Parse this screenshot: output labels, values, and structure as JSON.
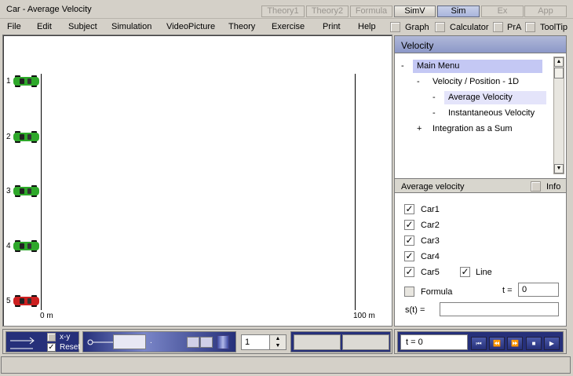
{
  "window": {
    "title": "Car - Average Velocity"
  },
  "mode_tabs": [
    {
      "label": "Theory1",
      "state": "disabled"
    },
    {
      "label": "Theory2",
      "state": "disabled"
    },
    {
      "label": "Formula",
      "state": "disabled"
    },
    {
      "label": "SimV",
      "state": "enabled"
    },
    {
      "label": "Sim",
      "state": "active"
    },
    {
      "label": "Ex",
      "state": "disabled"
    },
    {
      "label": "App",
      "state": "disabled"
    }
  ],
  "menu": {
    "items": [
      "File",
      "Edit",
      "Subject",
      "Simulation",
      "VideoPicture",
      "Theory",
      "Exercise",
      "Print",
      "Help"
    ],
    "toggles": [
      "Graph",
      "Calculator",
      "PrA",
      "ToolTip"
    ]
  },
  "simulation": {
    "start_label": "0 m",
    "end_label": "100 m",
    "cars": [
      {
        "number": "1",
        "color": "#2ea82a",
        "position_m": 0
      },
      {
        "number": "2",
        "color": "#2ea82a",
        "position_m": 0
      },
      {
        "number": "3",
        "color": "#2ea82a",
        "position_m": 0
      },
      {
        "number": "4",
        "color": "#2ea82a",
        "position_m": 0
      },
      {
        "number": "5",
        "color": "#cc2020",
        "position_m": 0
      }
    ]
  },
  "velocity_panel": {
    "header": "Velocity",
    "tree": [
      {
        "dash": "-",
        "label": "Main Menu",
        "state": "selected"
      },
      {
        "dash": "-",
        "label": "Velocity / Position - 1D",
        "state": ""
      },
      {
        "dash": "-",
        "label": "Average Velocity",
        "state": "highlight"
      },
      {
        "dash": "-",
        "label": "Instantaneous Velocity",
        "state": ""
      },
      {
        "dash": "+",
        "label": "Integration as a Sum",
        "state": ""
      }
    ]
  },
  "avg_panel": {
    "title": "Average velocity",
    "info_label": "Info",
    "cars": [
      {
        "label": "Car1",
        "checked": true
      },
      {
        "label": "Car2",
        "checked": true
      },
      {
        "label": "Car3",
        "checked": true
      },
      {
        "label": "Car4",
        "checked": true
      },
      {
        "label": "Car5",
        "checked": true
      }
    ],
    "line": {
      "label": "Line",
      "checked": true
    },
    "formula": {
      "label": "Formula",
      "checked": false
    },
    "t_label": "t =",
    "t_value": "0",
    "s_label": "s(t) =",
    "s_value": ""
  },
  "controls": {
    "xy_label": "x-y",
    "reset_label": "Reset",
    "reset_checked": true,
    "slider_dot": ".",
    "stepper_value": "1",
    "time_display": "t = 0",
    "play_buttons": [
      {
        "name": "rewind-to-start",
        "glyph": "⏮"
      },
      {
        "name": "step-back",
        "glyph": "⏪"
      },
      {
        "name": "step-forward",
        "glyph": "⏩"
      },
      {
        "name": "stop",
        "glyph": "■"
      },
      {
        "name": "play",
        "glyph": "▶"
      }
    ]
  },
  "status": {
    "text": ""
  }
}
